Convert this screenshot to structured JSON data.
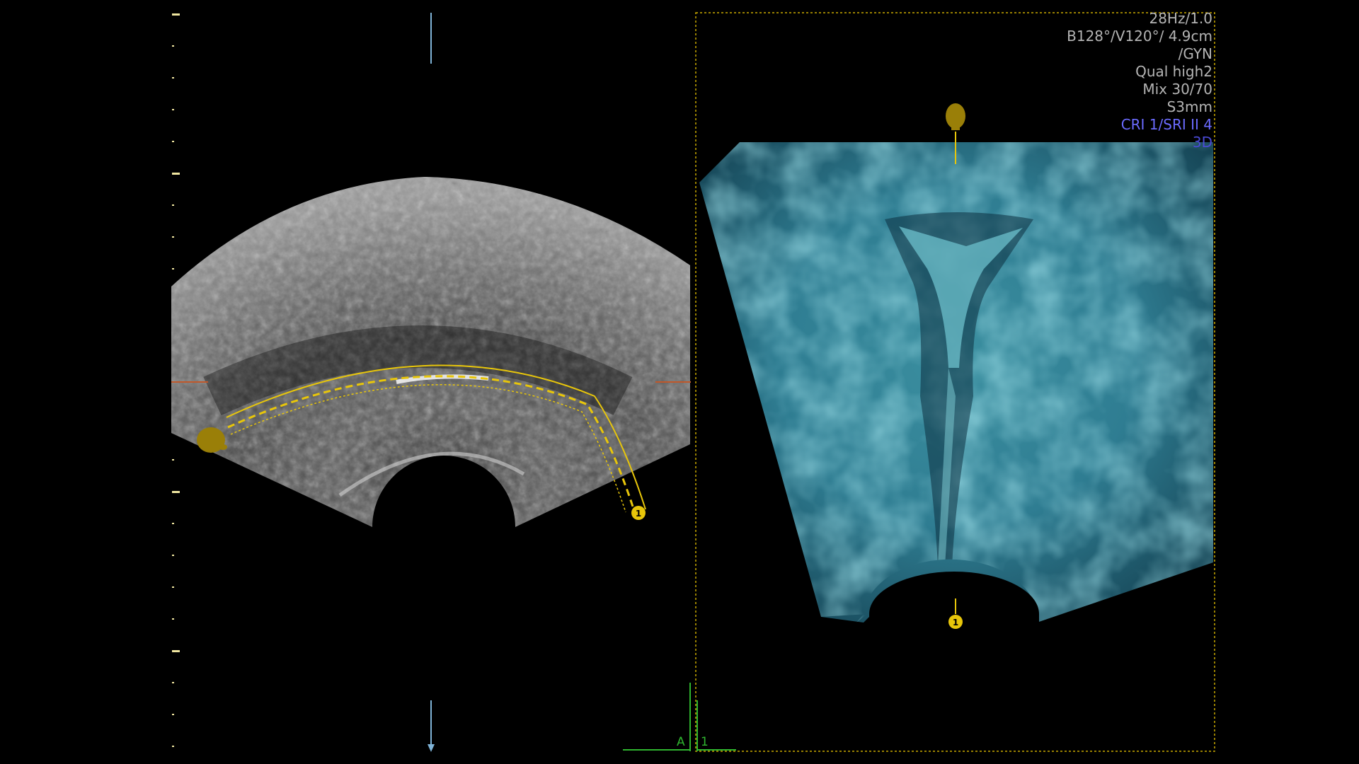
{
  "info_panel": {
    "lines": [
      {
        "text": "28Hz/1.0",
        "color": "#b4b4b4"
      },
      {
        "text": "B128°/V120°/ 4.9cm",
        "color": "#b4b4b4"
      },
      {
        "text": "/GYN",
        "color": "#b4b4b4"
      },
      {
        "text": "Qual high2",
        "color": "#b4b4b4"
      },
      {
        "text": "Mix 30/70",
        "color": "#b4b4b4"
      },
      {
        "text": "S3mm",
        "color": "#b4b4b4"
      },
      {
        "text": "CRI 1/SRI II 4",
        "color": "#6b6bff"
      },
      {
        "text": "3D",
        "color": "#4b4bd8"
      }
    ]
  },
  "render_markers": {
    "curve_marker_label": "1",
    "bottom_marker_label": "1"
  },
  "axis_labels": {
    "green_a": "A",
    "green_1": "1"
  },
  "colors": {
    "accent_yellow": "#e8c60a",
    "marker_gold": "#9a7f08",
    "frame_yellow": "#c9a900",
    "axis_blue": "#7fb4d8",
    "axis_green": "#2fb52f",
    "crosshair_orange": "#c0582a",
    "render_teal": "#3e9fb0"
  }
}
